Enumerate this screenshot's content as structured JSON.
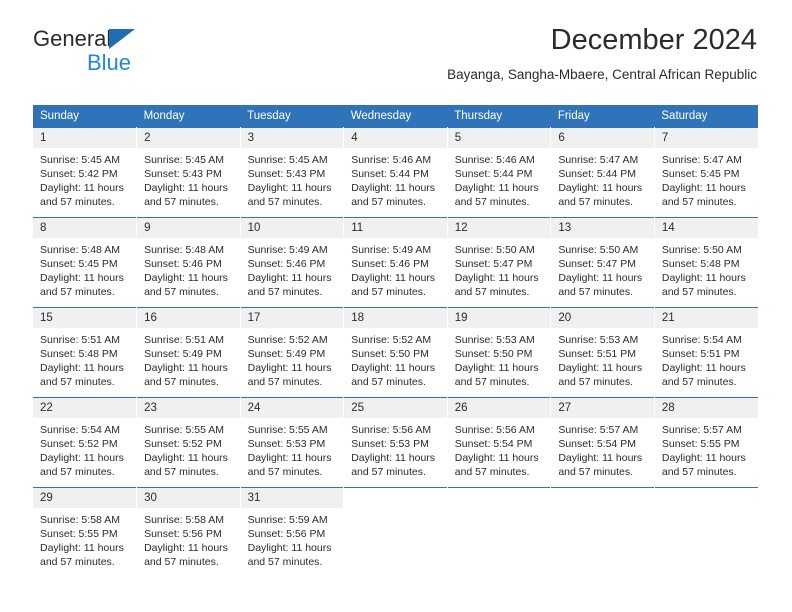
{
  "brand": {
    "name_top": "General",
    "name_bottom": "Blue",
    "triangle_icon": "brand-triangle-icon",
    "accent_dark": "#1f6eb5",
    "accent_light": "#2389d8"
  },
  "header": {
    "title": "December 2024",
    "subtitle": "Bayanga, Sangha-Mbaere, Central African Republic"
  },
  "theme": {
    "header_blue": "#2f74b8",
    "daynum_bg": "#f0f0f0",
    "text": "#2b2b2b"
  },
  "weekdays": [
    "Sunday",
    "Monday",
    "Tuesday",
    "Wednesday",
    "Thursday",
    "Friday",
    "Saturday"
  ],
  "weeks": [
    [
      {
        "day": "1",
        "sunrise": "Sunrise: 5:45 AM",
        "sunset": "Sunset: 5:42 PM",
        "daylight": "Daylight: 11 hours and 57 minutes."
      },
      {
        "day": "2",
        "sunrise": "Sunrise: 5:45 AM",
        "sunset": "Sunset: 5:43 PM",
        "daylight": "Daylight: 11 hours and 57 minutes."
      },
      {
        "day": "3",
        "sunrise": "Sunrise: 5:45 AM",
        "sunset": "Sunset: 5:43 PM",
        "daylight": "Daylight: 11 hours and 57 minutes."
      },
      {
        "day": "4",
        "sunrise": "Sunrise: 5:46 AM",
        "sunset": "Sunset: 5:44 PM",
        "daylight": "Daylight: 11 hours and 57 minutes."
      },
      {
        "day": "5",
        "sunrise": "Sunrise: 5:46 AM",
        "sunset": "Sunset: 5:44 PM",
        "daylight": "Daylight: 11 hours and 57 minutes."
      },
      {
        "day": "6",
        "sunrise": "Sunrise: 5:47 AM",
        "sunset": "Sunset: 5:44 PM",
        "daylight": "Daylight: 11 hours and 57 minutes."
      },
      {
        "day": "7",
        "sunrise": "Sunrise: 5:47 AM",
        "sunset": "Sunset: 5:45 PM",
        "daylight": "Daylight: 11 hours and 57 minutes."
      }
    ],
    [
      {
        "day": "8",
        "sunrise": "Sunrise: 5:48 AM",
        "sunset": "Sunset: 5:45 PM",
        "daylight": "Daylight: 11 hours and 57 minutes."
      },
      {
        "day": "9",
        "sunrise": "Sunrise: 5:48 AM",
        "sunset": "Sunset: 5:46 PM",
        "daylight": "Daylight: 11 hours and 57 minutes."
      },
      {
        "day": "10",
        "sunrise": "Sunrise: 5:49 AM",
        "sunset": "Sunset: 5:46 PM",
        "daylight": "Daylight: 11 hours and 57 minutes."
      },
      {
        "day": "11",
        "sunrise": "Sunrise: 5:49 AM",
        "sunset": "Sunset: 5:46 PM",
        "daylight": "Daylight: 11 hours and 57 minutes."
      },
      {
        "day": "12",
        "sunrise": "Sunrise: 5:50 AM",
        "sunset": "Sunset: 5:47 PM",
        "daylight": "Daylight: 11 hours and 57 minutes."
      },
      {
        "day": "13",
        "sunrise": "Sunrise: 5:50 AM",
        "sunset": "Sunset: 5:47 PM",
        "daylight": "Daylight: 11 hours and 57 minutes."
      },
      {
        "day": "14",
        "sunrise": "Sunrise: 5:50 AM",
        "sunset": "Sunset: 5:48 PM",
        "daylight": "Daylight: 11 hours and 57 minutes."
      }
    ],
    [
      {
        "day": "15",
        "sunrise": "Sunrise: 5:51 AM",
        "sunset": "Sunset: 5:48 PM",
        "daylight": "Daylight: 11 hours and 57 minutes."
      },
      {
        "day": "16",
        "sunrise": "Sunrise: 5:51 AM",
        "sunset": "Sunset: 5:49 PM",
        "daylight": "Daylight: 11 hours and 57 minutes."
      },
      {
        "day": "17",
        "sunrise": "Sunrise: 5:52 AM",
        "sunset": "Sunset: 5:49 PM",
        "daylight": "Daylight: 11 hours and 57 minutes."
      },
      {
        "day": "18",
        "sunrise": "Sunrise: 5:52 AM",
        "sunset": "Sunset: 5:50 PM",
        "daylight": "Daylight: 11 hours and 57 minutes."
      },
      {
        "day": "19",
        "sunrise": "Sunrise: 5:53 AM",
        "sunset": "Sunset: 5:50 PM",
        "daylight": "Daylight: 11 hours and 57 minutes."
      },
      {
        "day": "20",
        "sunrise": "Sunrise: 5:53 AM",
        "sunset": "Sunset: 5:51 PM",
        "daylight": "Daylight: 11 hours and 57 minutes."
      },
      {
        "day": "21",
        "sunrise": "Sunrise: 5:54 AM",
        "sunset": "Sunset: 5:51 PM",
        "daylight": "Daylight: 11 hours and 57 minutes."
      }
    ],
    [
      {
        "day": "22",
        "sunrise": "Sunrise: 5:54 AM",
        "sunset": "Sunset: 5:52 PM",
        "daylight": "Daylight: 11 hours and 57 minutes."
      },
      {
        "day": "23",
        "sunrise": "Sunrise: 5:55 AM",
        "sunset": "Sunset: 5:52 PM",
        "daylight": "Daylight: 11 hours and 57 minutes."
      },
      {
        "day": "24",
        "sunrise": "Sunrise: 5:55 AM",
        "sunset": "Sunset: 5:53 PM",
        "daylight": "Daylight: 11 hours and 57 minutes."
      },
      {
        "day": "25",
        "sunrise": "Sunrise: 5:56 AM",
        "sunset": "Sunset: 5:53 PM",
        "daylight": "Daylight: 11 hours and 57 minutes."
      },
      {
        "day": "26",
        "sunrise": "Sunrise: 5:56 AM",
        "sunset": "Sunset: 5:54 PM",
        "daylight": "Daylight: 11 hours and 57 minutes."
      },
      {
        "day": "27",
        "sunrise": "Sunrise: 5:57 AM",
        "sunset": "Sunset: 5:54 PM",
        "daylight": "Daylight: 11 hours and 57 minutes."
      },
      {
        "day": "28",
        "sunrise": "Sunrise: 5:57 AM",
        "sunset": "Sunset: 5:55 PM",
        "daylight": "Daylight: 11 hours and 57 minutes."
      }
    ],
    [
      {
        "day": "29",
        "sunrise": "Sunrise: 5:58 AM",
        "sunset": "Sunset: 5:55 PM",
        "daylight": "Daylight: 11 hours and 57 minutes."
      },
      {
        "day": "30",
        "sunrise": "Sunrise: 5:58 AM",
        "sunset": "Sunset: 5:56 PM",
        "daylight": "Daylight: 11 hours and 57 minutes."
      },
      {
        "day": "31",
        "sunrise": "Sunrise: 5:59 AM",
        "sunset": "Sunset: 5:56 PM",
        "daylight": "Daylight: 11 hours and 57 minutes."
      },
      {
        "day": "",
        "sunrise": "",
        "sunset": "",
        "daylight": ""
      },
      {
        "day": "",
        "sunrise": "",
        "sunset": "",
        "daylight": ""
      },
      {
        "day": "",
        "sunrise": "",
        "sunset": "",
        "daylight": ""
      },
      {
        "day": "",
        "sunrise": "",
        "sunset": "",
        "daylight": ""
      }
    ]
  ]
}
